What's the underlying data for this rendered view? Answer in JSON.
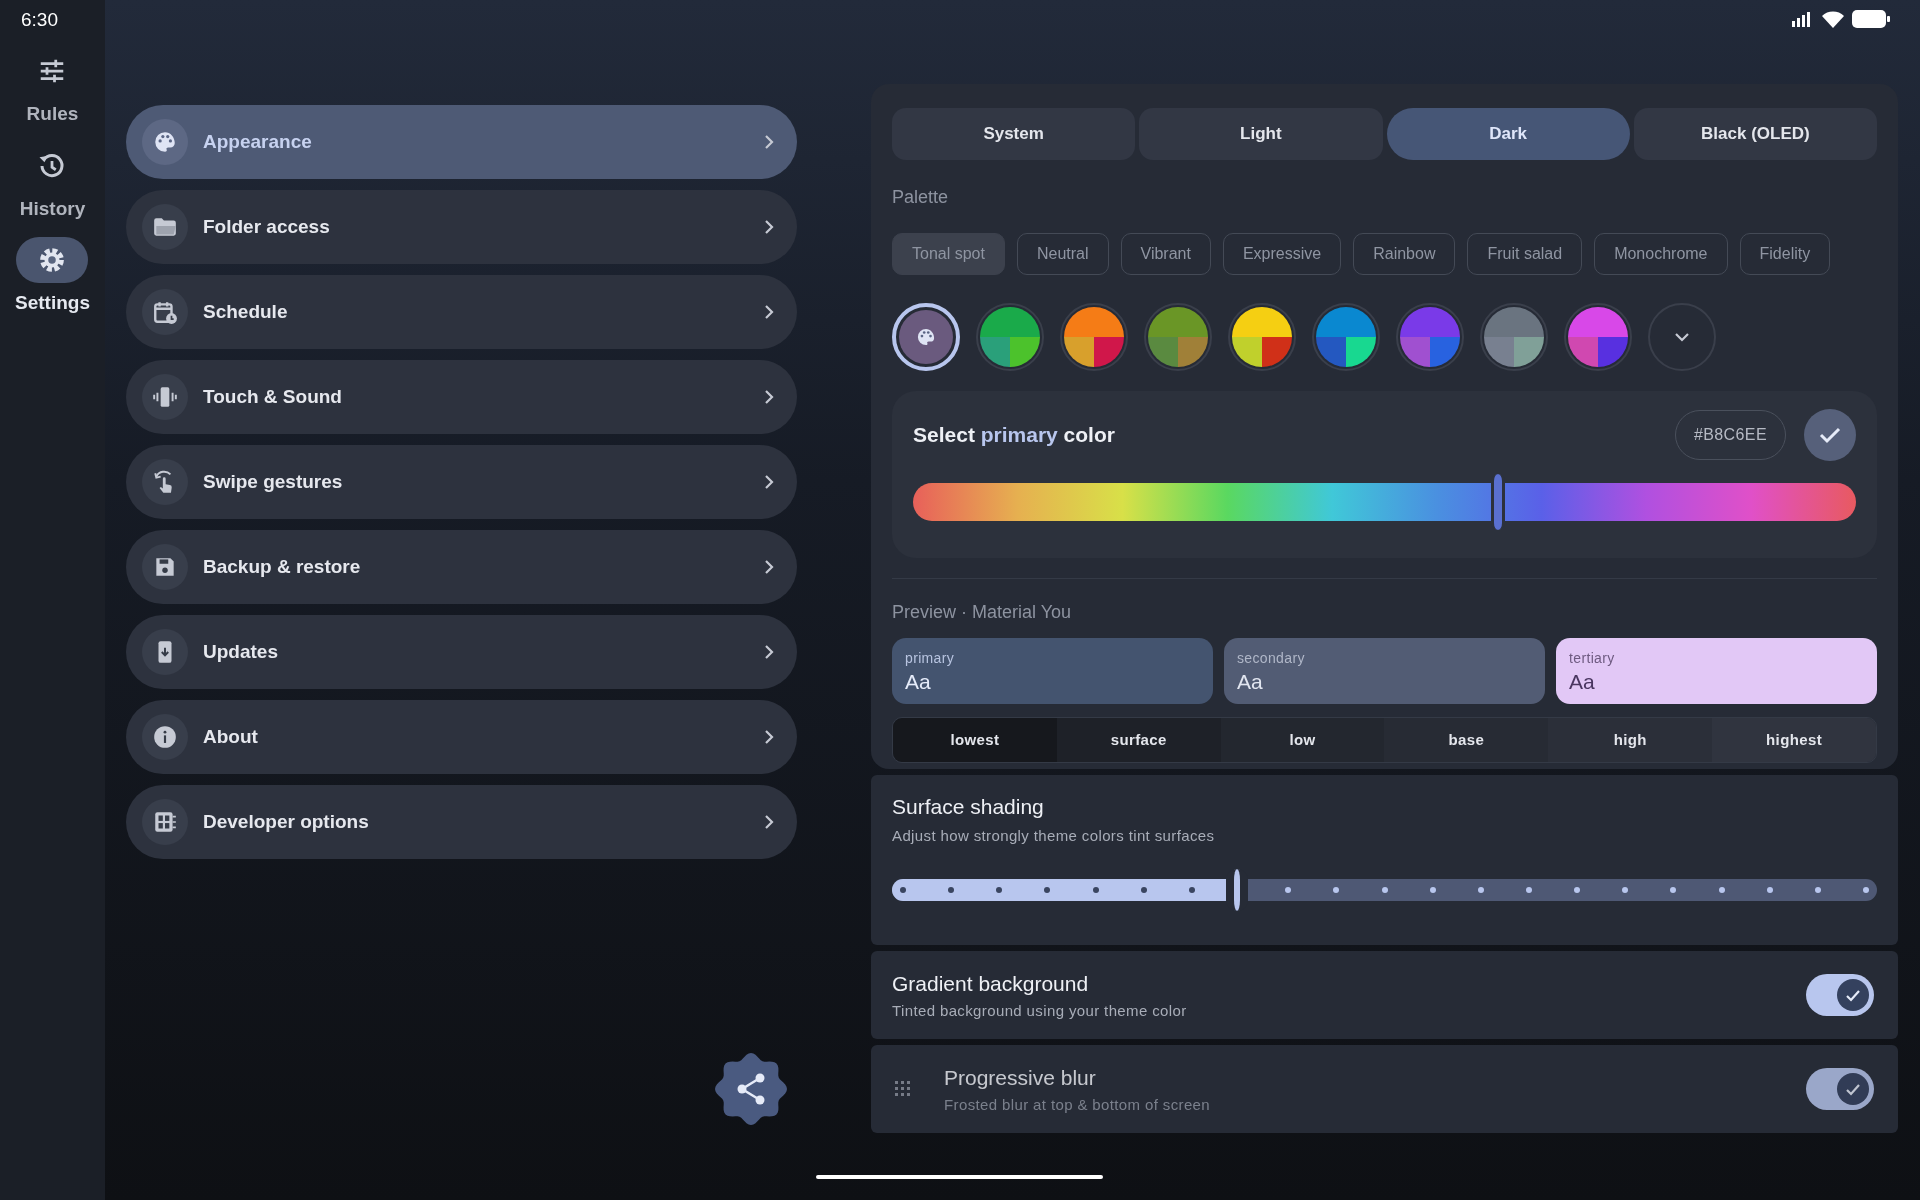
{
  "status_bar": {
    "time": "6:30"
  },
  "nav_rail": [
    {
      "label": "Rules",
      "selected": false
    },
    {
      "label": "History",
      "selected": false
    },
    {
      "label": "Settings",
      "selected": true
    }
  ],
  "menu": [
    {
      "label": "Appearance",
      "selected": true
    },
    {
      "label": "Folder access",
      "selected": false
    },
    {
      "label": "Schedule",
      "selected": false
    },
    {
      "label": "Touch & Sound",
      "selected": false
    },
    {
      "label": "Swipe gestures",
      "selected": false
    },
    {
      "label": "Backup & restore",
      "selected": false
    },
    {
      "label": "Updates",
      "selected": false
    },
    {
      "label": "About",
      "selected": false
    },
    {
      "label": "Developer options",
      "selected": false
    }
  ],
  "theme_modes": [
    {
      "label": "System",
      "selected": false
    },
    {
      "label": "Light",
      "selected": false
    },
    {
      "label": "Dark",
      "selected": true
    },
    {
      "label": "Black (OLED)",
      "selected": false
    }
  ],
  "palette": {
    "label": "Palette",
    "styles": [
      {
        "label": "Tonal spot",
        "selected": true
      },
      {
        "label": "Neutral",
        "selected": false
      },
      {
        "label": "Vibrant",
        "selected": false
      },
      {
        "label": "Expressive",
        "selected": false
      },
      {
        "label": "Rainbow",
        "selected": false
      },
      {
        "label": "Fruit salad",
        "selected": false
      },
      {
        "label": "Monochrome",
        "selected": false
      },
      {
        "label": "Fidelity",
        "selected": false
      }
    ],
    "swatches": [
      {
        "kind": "custom",
        "selected": true,
        "color": "#6a5a7e"
      },
      {
        "kind": "preset",
        "selected": false,
        "color": "#1aaa4a"
      },
      {
        "kind": "preset",
        "selected": false,
        "color": "#f57c16"
      },
      {
        "kind": "preset",
        "selected": false,
        "color": "#6a9626"
      },
      {
        "kind": "preset",
        "selected": false,
        "color": "#f5cf12"
      },
      {
        "kind": "preset",
        "selected": false,
        "color": "#0a88d0"
      },
      {
        "kind": "preset",
        "selected": false,
        "color": "#7a3ae8"
      },
      {
        "kind": "preset",
        "selected": false,
        "color": "#6a7480"
      },
      {
        "kind": "preset",
        "selected": false,
        "color": "#d848e8"
      }
    ]
  },
  "primary_color": {
    "title_before": "Select",
    "title_highlight": "primary",
    "title_after": "color",
    "hex": "#B8C6EE",
    "level": 0.62
  },
  "preview": {
    "label": "Preview · Material You",
    "cards": [
      {
        "kind": "primary",
        "label": "primary",
        "sample": "Aa"
      },
      {
        "kind": "secondary",
        "label": "secondary",
        "sample": "Aa"
      },
      {
        "kind": "tertiary",
        "label": "tertiary",
        "sample": "Aa"
      }
    ],
    "surfaces": [
      "lowest",
      "surface",
      "low",
      "base",
      "high",
      "highest"
    ]
  },
  "surface_shading": {
    "title": "Surface shading",
    "subtitle": "Adjust how strongly theme colors tint surfaces",
    "level": 0.35
  },
  "toggles": [
    {
      "kind": "plain",
      "title": "Gradient background",
      "subtitle": "Tinted background using your theme color",
      "on": true
    },
    {
      "kind": "faded",
      "title": "Progressive blur",
      "subtitle": "Frosted blur at top & bottom of screen",
      "on": true
    }
  ]
}
